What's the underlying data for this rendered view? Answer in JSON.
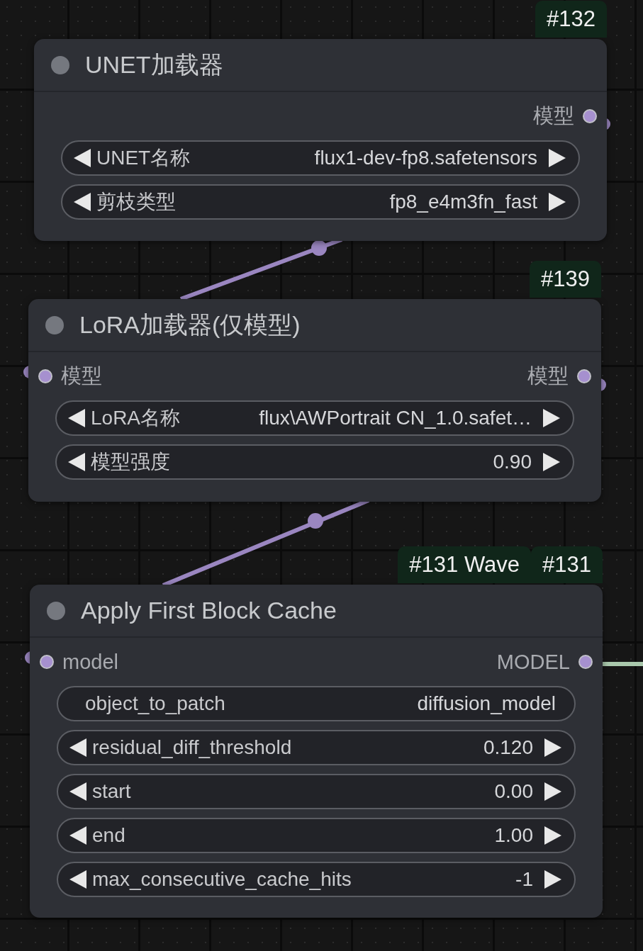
{
  "nodes": [
    {
      "badges": [
        "#132"
      ],
      "title": "UNET加载器",
      "outputs": [
        "模型"
      ],
      "widgets": [
        {
          "kind": "combo",
          "label": "UNET名称",
          "value": "flux1-dev-fp8.safetensors"
        },
        {
          "kind": "combo",
          "label": "剪枝类型",
          "value": "fp8_e4m3fn_fast"
        }
      ]
    },
    {
      "badges": [
        "#139"
      ],
      "title": "LoRA加载器(仅模型)",
      "inputs": [
        "模型"
      ],
      "outputs": [
        "模型"
      ],
      "widgets": [
        {
          "kind": "combo",
          "label": "LoRA名称",
          "value": "flux\\AWPortrait CN_1.0.safet…"
        },
        {
          "kind": "number",
          "label": "模型强度",
          "value": "0.90"
        }
      ]
    },
    {
      "badges": [
        "#131 Wave",
        "#131"
      ],
      "title": "Apply First Block Cache",
      "inputs": [
        "model"
      ],
      "outputs": [
        "MODEL"
      ],
      "widgets": [
        {
          "kind": "text",
          "label": "object_to_patch",
          "value": "diffusion_model"
        },
        {
          "kind": "number",
          "label": "residual_diff_threshold",
          "value": "0.120"
        },
        {
          "kind": "number",
          "label": "start",
          "value": "0.00"
        },
        {
          "kind": "number",
          "label": "end",
          "value": "1.00"
        },
        {
          "kind": "number",
          "label": "max_consecutive_cache_hits",
          "value": "-1"
        }
      ]
    }
  ]
}
